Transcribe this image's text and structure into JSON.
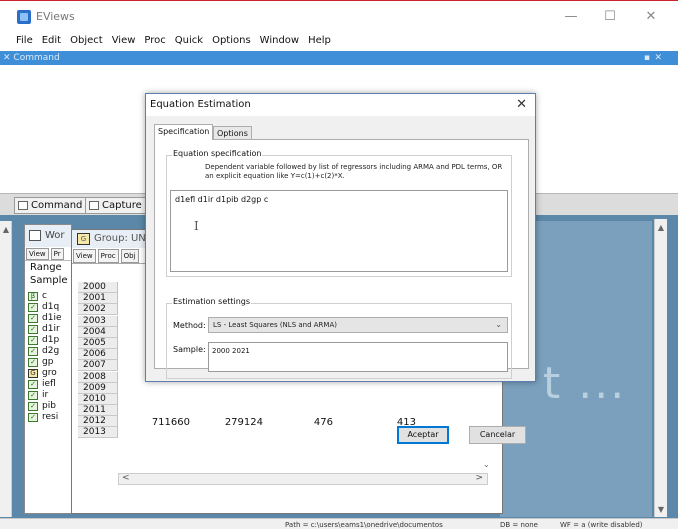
{
  "app": {
    "title": "EViews",
    "minimize": "—",
    "maximize": "☐",
    "close": "✕"
  },
  "menu": [
    "File",
    "Edit",
    "Object",
    "View",
    "Proc",
    "Quick",
    "Options",
    "Window",
    "Help"
  ],
  "command_panel": {
    "title": "Command",
    "pin": "▪",
    "close": "✕",
    "tabs": [
      "Command",
      "Capture"
    ]
  },
  "workfile": {
    "title": "Wor",
    "toolbar": [
      "View",
      "Pr"
    ],
    "range_label": "Range",
    "sample_label": "Sample",
    "objects": [
      {
        "name": "c",
        "type": "β"
      },
      {
        "name": "d1q",
        "type": "✓"
      },
      {
        "name": "d1ie",
        "type": "✓"
      },
      {
        "name": "d1ir",
        "type": "✓"
      },
      {
        "name": "d1p",
        "type": "✓"
      },
      {
        "name": "d2g",
        "type": "✓"
      },
      {
        "name": "gp",
        "type": "✓"
      },
      {
        "name": "gro",
        "type": "G"
      },
      {
        "name": "iefl",
        "type": "✓"
      },
      {
        "name": "ir",
        "type": "✓"
      },
      {
        "name": "pib",
        "type": "✓"
      },
      {
        "name": "resi",
        "type": "✓"
      }
    ]
  },
  "group": {
    "title": "Group: UN",
    "icon": "G",
    "toolbar": [
      "View",
      "Proc",
      "Obj"
    ],
    "years": [
      "2000",
      "2001",
      "2002",
      "2003",
      "2004",
      "2005",
      "2006",
      "2007",
      "2008",
      "2009",
      "2010",
      "2011",
      "2012",
      "2013"
    ],
    "last_row": [
      "711660",
      "279124",
      "476",
      "413"
    ],
    "nav_left": "<",
    "nav_right": ">",
    "nav_down": "⌄"
  },
  "background_text": "t ...",
  "statusbar": {
    "path": "Path = c:\\users\\eams1\\onedrive\\documentos",
    "db": "DB = none",
    "wf": "WF = a (write disabled)"
  },
  "dialog": {
    "title": "Equation Estimation",
    "close": "✕",
    "tabs": [
      "Specification",
      "Options"
    ],
    "spec_group_label": "Equation specification",
    "spec_description": "Dependent variable followed by list of regressors including ARMA and PDL terms, OR an explicit equation like Y=c(1)+c(2)*X.",
    "spec_value": "d1efl d1ir d1pib d2gp c",
    "settings_group_label": "Estimation settings",
    "method_label": "Method:",
    "method_value": "LS  -  Least Squares (NLS and ARMA)",
    "sample_label": "Sample:",
    "sample_value": "2000 2021",
    "ok_label": "Aceptar",
    "cancel_label": "Cancelar"
  },
  "colors": {
    "accent_border": "#c8242c",
    "command_header": "#3f8fd8",
    "workspace": "#5b87a8",
    "default_button_border": "#0078d7"
  }
}
